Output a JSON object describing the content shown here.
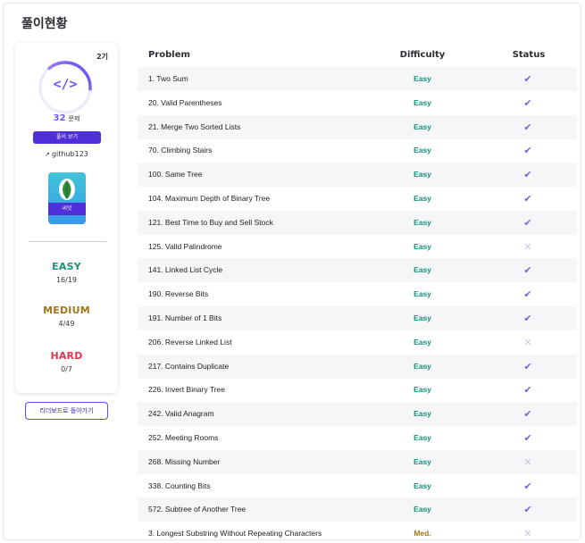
{
  "page": {
    "title": "풀이현황"
  },
  "profile": {
    "generation": "2기",
    "progress_ratio": 0.37,
    "solved_number": "32",
    "solved_unit": "문제",
    "view_solutions_label": "풀이 보기",
    "github_icon": "external-link-icon",
    "github_username": "github123",
    "tier_label": "씨앗",
    "tier_icon": "seed-icon"
  },
  "difficulty_summary": {
    "easy": {
      "label": "EASY",
      "count": "16/19"
    },
    "medium": {
      "label": "MEDIUM",
      "count": "4/49"
    },
    "hard": {
      "label": "HARD",
      "count": "0/7"
    }
  },
  "back_button_label": "리더보드로 돌아가기",
  "table": {
    "headers": {
      "problem": "Problem",
      "difficulty": "Difficulty",
      "status": "Status"
    },
    "rows": [
      {
        "problem": "1. Two Sum",
        "difficulty": "Easy",
        "solved": true
      },
      {
        "problem": "20. Valid Parentheses",
        "difficulty": "Easy",
        "solved": true
      },
      {
        "problem": "21. Merge Two Sorted Lists",
        "difficulty": "Easy",
        "solved": true
      },
      {
        "problem": "70. Climbing Stairs",
        "difficulty": "Easy",
        "solved": true
      },
      {
        "problem": "100. Same Tree",
        "difficulty": "Easy",
        "solved": true
      },
      {
        "problem": "104. Maximum Depth of Binary Tree",
        "difficulty": "Easy",
        "solved": true
      },
      {
        "problem": "121. Best Time to Buy and Sell Stock",
        "difficulty": "Easy",
        "solved": true
      },
      {
        "problem": "125. Valid Palindrome",
        "difficulty": "Easy",
        "solved": false
      },
      {
        "problem": "141. Linked List Cycle",
        "difficulty": "Easy",
        "solved": true
      },
      {
        "problem": "190. Reverse Bits",
        "difficulty": "Easy",
        "solved": true
      },
      {
        "problem": "191. Number of 1 Bits",
        "difficulty": "Easy",
        "solved": true
      },
      {
        "problem": "206. Reverse Linked List",
        "difficulty": "Easy",
        "solved": false
      },
      {
        "problem": "217. Contains Duplicate",
        "difficulty": "Easy",
        "solved": true
      },
      {
        "problem": "226. Invert Binary Tree",
        "difficulty": "Easy",
        "solved": true
      },
      {
        "problem": "242. Valid Anagram",
        "difficulty": "Easy",
        "solved": true
      },
      {
        "problem": "252. Meeting Rooms",
        "difficulty": "Easy",
        "solved": true
      },
      {
        "problem": "268. Missing Number",
        "difficulty": "Easy",
        "solved": false
      },
      {
        "problem": "338. Counting Bits",
        "difficulty": "Easy",
        "solved": true
      },
      {
        "problem": "572. Subtree of Another Tree",
        "difficulty": "Easy",
        "solved": true
      },
      {
        "problem": "3. Longest Substring Without Repeating Characters",
        "difficulty": "Med.",
        "solved": false
      }
    ]
  },
  "colors": {
    "accent": "#6a5cf0",
    "button": "#4f2fd8",
    "easy": "#16927d",
    "medium": "#a0781c",
    "hard": "#e6354f",
    "check": "#7367d6",
    "cross": "#c6c6dc"
  }
}
